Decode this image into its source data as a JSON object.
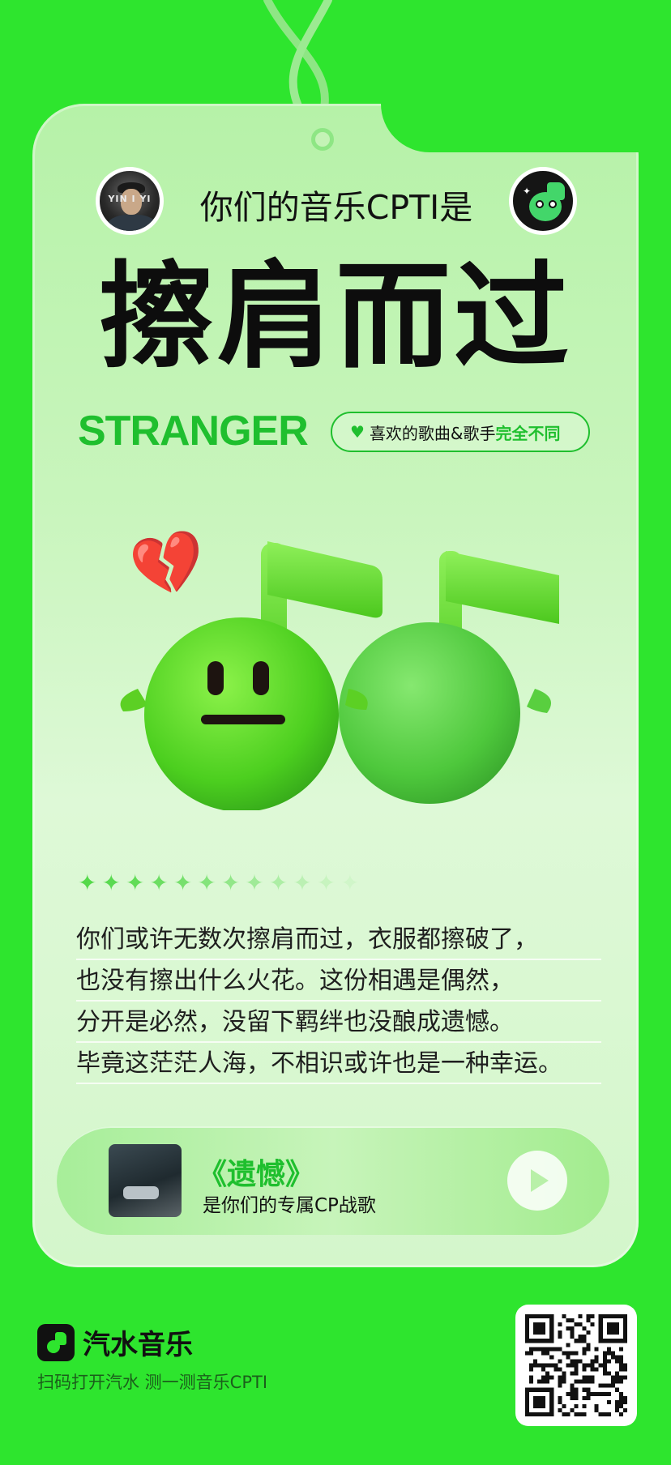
{
  "header": {
    "title": "你们的音乐CPTI是",
    "avatar_left_tag": "YIN  I YI"
  },
  "result": {
    "title": "擦肩而过",
    "english": "STRANGER",
    "pill_text": "喜欢的歌曲&歌手",
    "pill_highlight": "完全不同"
  },
  "description": {
    "lines": [
      "你们或许无数次擦肩而过，衣服都擦破了，",
      "也没有擦出什么火花。这份相遇是偶然，",
      "分开是必然，没留下羁绊也没酿成遗憾。",
      "毕竟这茫茫人海，不相识或许也是一种幸运。"
    ]
  },
  "song": {
    "name": "《遗憾》",
    "subtitle": "是你们的专属CP战歌"
  },
  "footer": {
    "brand": "汽水音乐",
    "hint": "扫码打开汽水  测一测音乐CPTI"
  },
  "icons": {
    "heart": "♥",
    "broken_heart": "💔",
    "sparkle": "✦"
  },
  "colors": {
    "background": "#2ee52e",
    "accent": "#1fbf2e",
    "card": "#c9f5bd"
  }
}
